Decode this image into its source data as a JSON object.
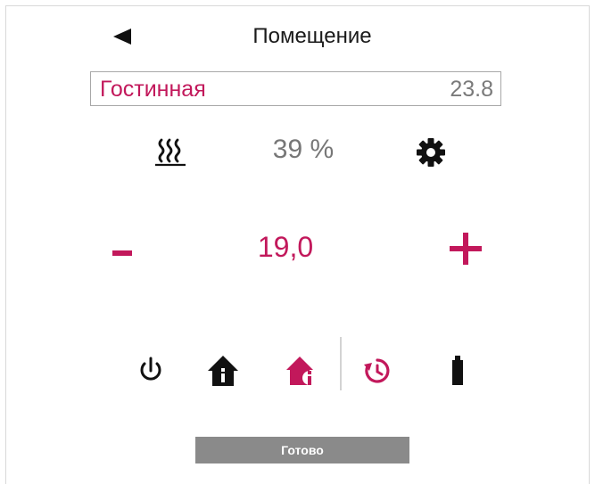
{
  "header": {
    "title": "Помещение",
    "back_icon": "back-triangle-icon"
  },
  "room": {
    "name": "Гостинная",
    "temperature": "23.8"
  },
  "status": {
    "heating_icon": "heating-waves-icon",
    "heating_percent": "39 %",
    "settings_icon": "gear-icon"
  },
  "setpoint": {
    "value": "19,0",
    "decrease_label": "-",
    "increase_label": "+"
  },
  "modes": {
    "items": [
      {
        "name": "power-icon",
        "active": false
      },
      {
        "name": "home-info-icon",
        "active": false
      },
      {
        "name": "home-info-icon",
        "active": true
      },
      {
        "name": "timer-icon",
        "active": true
      },
      {
        "name": "battery-icon",
        "active": false
      }
    ]
  },
  "footer": {
    "done_label": "Готово"
  },
  "colors": {
    "accent": "#c2185b",
    "muted_text": "#777777",
    "button_gray": "#8a8a8a"
  }
}
